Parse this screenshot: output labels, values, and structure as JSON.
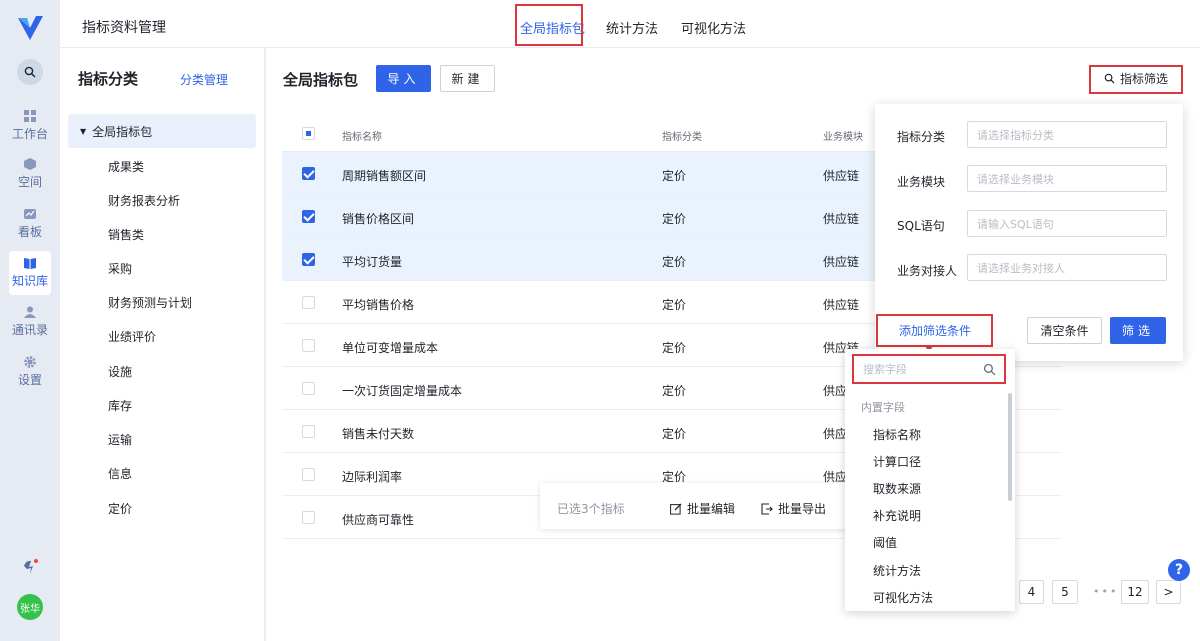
{
  "rail": {
    "items": [
      {
        "label": "工作台",
        "icon": "dashboard-icon"
      },
      {
        "label": "空间",
        "icon": "cube-icon"
      },
      {
        "label": "看板",
        "icon": "board-icon"
      },
      {
        "label": "知识库",
        "icon": "book-icon"
      },
      {
        "label": "通讯录",
        "icon": "user-icon"
      },
      {
        "label": "设置",
        "icon": "gear-icon"
      }
    ],
    "active": "知识库",
    "avatar": "张华"
  },
  "header": {
    "app_title": "指标资料管理",
    "tabs": [
      "全局指标包",
      "统计方法",
      "可视化方法"
    ],
    "active_tab": "全局指标包"
  },
  "categories": {
    "title": "指标分类",
    "manage": "分类管理",
    "root": "全局指标包",
    "items": [
      "成果类",
      "财务报表分析",
      "销售类",
      "采购",
      "财务预测与计划",
      "业绩评价",
      "设施",
      "库存",
      "运输",
      "信息",
      "定价"
    ]
  },
  "main": {
    "title": "全局指标包",
    "import_label": "导入",
    "new_label": "新建",
    "filter_label": "指标筛选",
    "columns": [
      "指标名称",
      "指标分类",
      "业务模块"
    ],
    "rows": [
      {
        "name": "周期销售额区间",
        "category": "定价",
        "module": "供应链",
        "checked": true
      },
      {
        "name": "销售价格区间",
        "category": "定价",
        "module": "供应链",
        "checked": true
      },
      {
        "name": "平均订货量",
        "category": "定价",
        "module": "供应链",
        "checked": true
      },
      {
        "name": "平均销售价格",
        "category": "定价",
        "module": "供应链",
        "checked": false
      },
      {
        "name": "单位可变增量成本",
        "category": "定价",
        "module": "供应链",
        "checked": false
      },
      {
        "name": "一次订货固定增量成本",
        "category": "定价",
        "module": "供应",
        "checked": false
      },
      {
        "name": "销售未付天数",
        "category": "定价",
        "module": "供应",
        "checked": false
      },
      {
        "name": "边际利润率",
        "category": "定价",
        "module": "供应",
        "checked": false
      },
      {
        "name": "供应商可靠性",
        "category": "",
        "module": "",
        "checked": false
      }
    ],
    "batch": {
      "count": "已选3个指标",
      "edit": "批量编辑",
      "export": "批量导出"
    },
    "pager": [
      "4",
      "5",
      "12",
      ">"
    ],
    "pager_dots": "•••",
    "help": "?"
  },
  "filter_popover": {
    "fields": [
      {
        "label": "指标分类",
        "placeholder": "请选择指标分类"
      },
      {
        "label": "业务模块",
        "placeholder": "请选择业务模块"
      },
      {
        "label": "SQL语句",
        "placeholder": "请输入SQL语句"
      },
      {
        "label": "业务对接人",
        "placeholder": "请选择业务对接人"
      }
    ],
    "add_condition": "添加筛选条件",
    "clear": "清空条件",
    "apply": "筛选"
  },
  "field_dropdown": {
    "search_placeholder": "搜索字段",
    "group": "内置字段",
    "items": [
      "指标名称",
      "计算口径",
      "取数来源",
      "补充说明",
      "阈值",
      "统计方法",
      "可视化方法"
    ]
  },
  "colors": {
    "accent": "#2f63e8",
    "highlight": "#d9363e",
    "selected_row": "#eaf3fd"
  }
}
